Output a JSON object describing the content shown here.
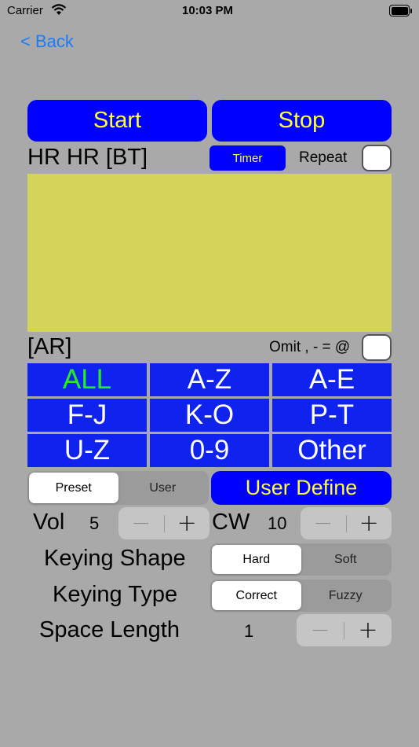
{
  "status_bar": {
    "carrier": "Carrier",
    "time": "10:03 PM"
  },
  "nav": {
    "back_label": "< Back"
  },
  "controls": {
    "start_label": "Start",
    "stop_label": "Stop"
  },
  "prosign_top": "HR HR [BT]",
  "timer_label": "Timer",
  "repeat_label": "Repeat",
  "display_text": "",
  "prosign_bottom": "[AR]",
  "omit_label": "Omit , - = @",
  "char_groups": [
    "ALL",
    "A-Z",
    "A-E",
    "F-J",
    "K-O",
    "P-T",
    "U-Z",
    "0-9",
    "Other"
  ],
  "selected_group_color": "#22ee22",
  "preset_segment": {
    "options": [
      "Preset",
      "User"
    ],
    "selected": "Preset"
  },
  "user_define_label": "User Define",
  "vol": {
    "label": "Vol",
    "value": "5"
  },
  "cw": {
    "label": "CW",
    "value": "10"
  },
  "stepper_symbols": {
    "minus": "−",
    "plus": "+"
  },
  "keying_shape": {
    "label": "Keying Shape",
    "options": [
      "Hard",
      "Soft"
    ],
    "selected": "Hard"
  },
  "keying_type": {
    "label": "Keying Type",
    "options": [
      "Correct",
      "Fuzzy"
    ],
    "selected": "Correct"
  },
  "space_length": {
    "label": "Space Length",
    "value": "1"
  },
  "colors": {
    "background": "#a9a9a9",
    "button_blue": "#0000ff",
    "button_text": "#ffff33",
    "display_area": "#d4d45a",
    "link": "#1a7cf5"
  }
}
